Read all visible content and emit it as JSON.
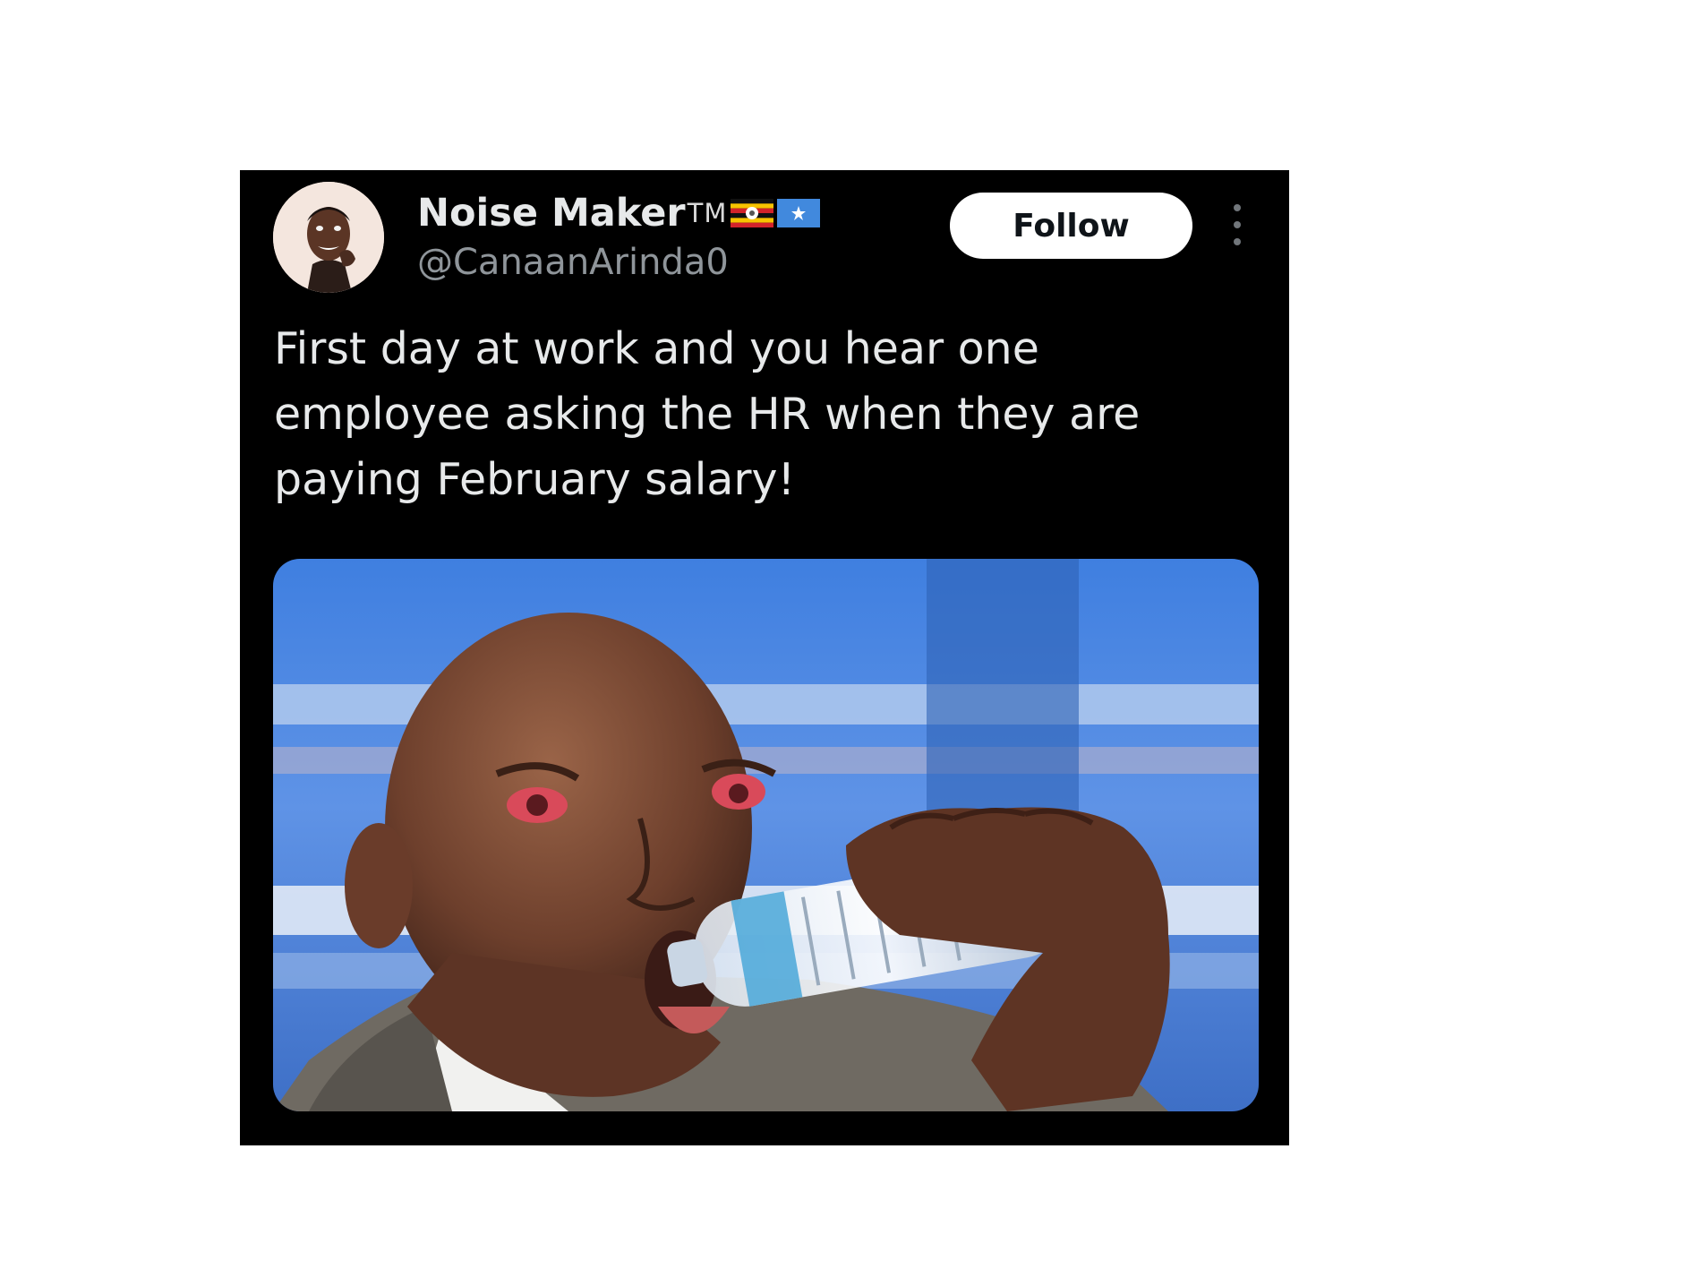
{
  "tweet": {
    "author": {
      "display_name": "Noise Maker",
      "trademark": "TM",
      "flags": [
        "uganda-flag-icon",
        "somalia-flag-icon"
      ],
      "handle": "@CanaanArinda0"
    },
    "follow_label": "Follow",
    "more_icon": "more-options-icon",
    "text": "First day at work and you hear one employee asking the HR when they are paying February salary!",
    "media": {
      "kind": "photo",
      "subject": "man-drinking-water-bottle"
    }
  },
  "colors": {
    "card_background": "#000000",
    "primary_text": "#e7e9ea",
    "secondary_text": "#8f959a",
    "follow_button_bg": "#ffffff",
    "follow_button_text": "#0f1419",
    "page_background": "#ffffff"
  }
}
